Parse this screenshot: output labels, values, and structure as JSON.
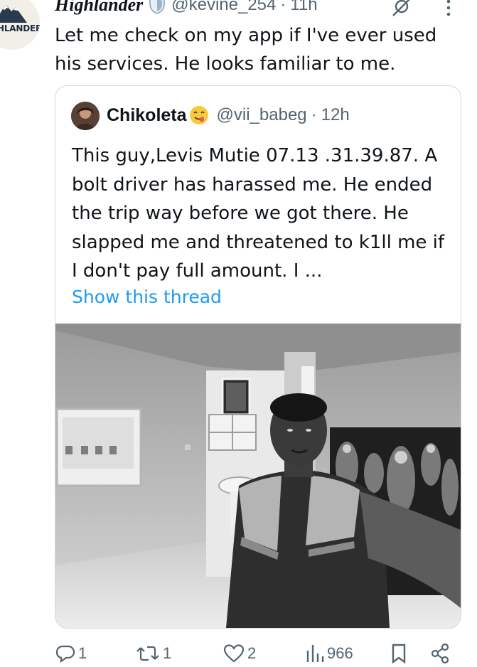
{
  "post": {
    "author": {
      "display_name": "Highlander",
      "handle": "@kevine_254",
      "time": "11h",
      "avatar_text": "HLANDER",
      "badge_icon": "shield-verified-icon"
    },
    "text": "Let me check on my app if I've ever used his services. He looks familiar to me.",
    "separator": "·",
    "icons": {
      "grok": "grok-icon",
      "more": "more-vertical-icon"
    }
  },
  "quote": {
    "author": {
      "display_name": "Chikoleta",
      "emoji": "face-savoring-food-emoji",
      "handle": "@vii_babeg",
      "time": "12h"
    },
    "separator": "·",
    "text": "This guy,Levis Mutie 07.13 .31.39.87. A bolt driver has harassed me. He ended the trip way before we got there. He slapped me and threatened to k1ll me if I don't pay full amount. I ...",
    "show_thread": "Show this thread",
    "media": {
      "type": "grayscale-photo",
      "description": ""
    }
  },
  "actions": {
    "replies": "1",
    "reposts": "1",
    "likes": "2",
    "views": "966"
  },
  "colors": {
    "text": "#0f1419",
    "secondary": "#536471",
    "link": "#1d9bf0",
    "border": "#cfd9de"
  }
}
